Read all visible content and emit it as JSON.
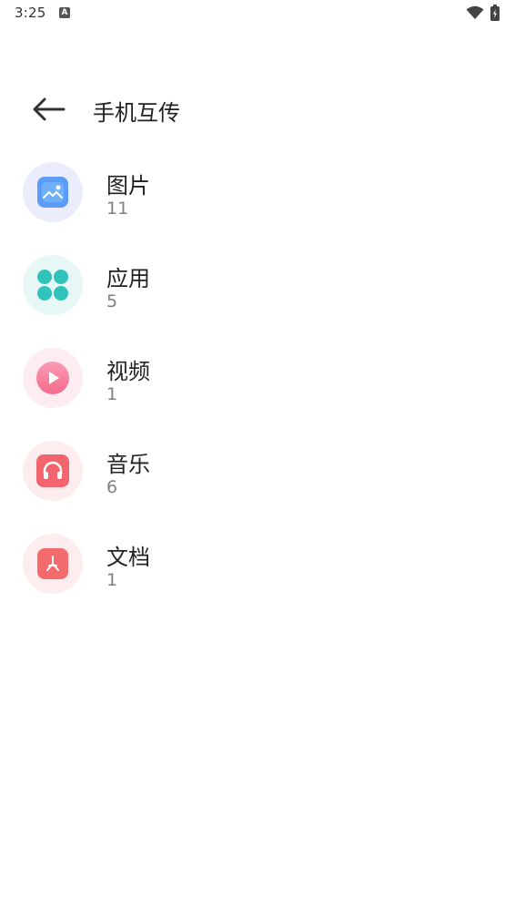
{
  "status_bar": {
    "time": "3:25",
    "notification_icon": "a-badge-icon",
    "wifi_icon": "wifi-icon",
    "battery_icon": "battery-icon"
  },
  "header": {
    "back_icon": "back-arrow-icon",
    "title": "手机互传"
  },
  "categories": [
    {
      "label": "图片",
      "count": "11",
      "icon": "image-icon",
      "circle_color": "#ecedfc",
      "tile_color": "#5b9cf7"
    },
    {
      "label": "应用",
      "count": "5",
      "icon": "app-grid-icon",
      "circle_color": "#e6f7f6",
      "tile_color": "#2fc3bb"
    },
    {
      "label": "视频",
      "count": "1",
      "icon": "video-icon",
      "circle_color": "#fdedf1",
      "tile_color": "#f67a98"
    },
    {
      "label": "音乐",
      "count": "6",
      "icon": "headphones-icon",
      "circle_color": "#fdedee",
      "tile_color": "#f2656e"
    },
    {
      "label": "文档",
      "count": "1",
      "icon": "pdf-icon",
      "circle_color": "#fdedee",
      "tile_color": "#f36b6d"
    }
  ]
}
